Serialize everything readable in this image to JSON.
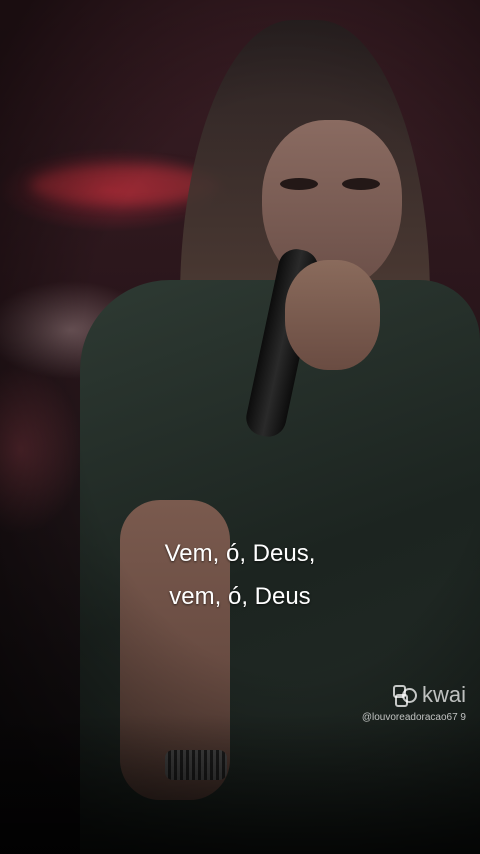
{
  "lyrics": {
    "line1": "Vem, ó, Deus,",
    "line2": "vem, ó, Deus"
  },
  "watermark": {
    "brand": "kwai",
    "handle": "@louvoreadoracao67 9",
    "icon": "kwai-logo-icon"
  }
}
